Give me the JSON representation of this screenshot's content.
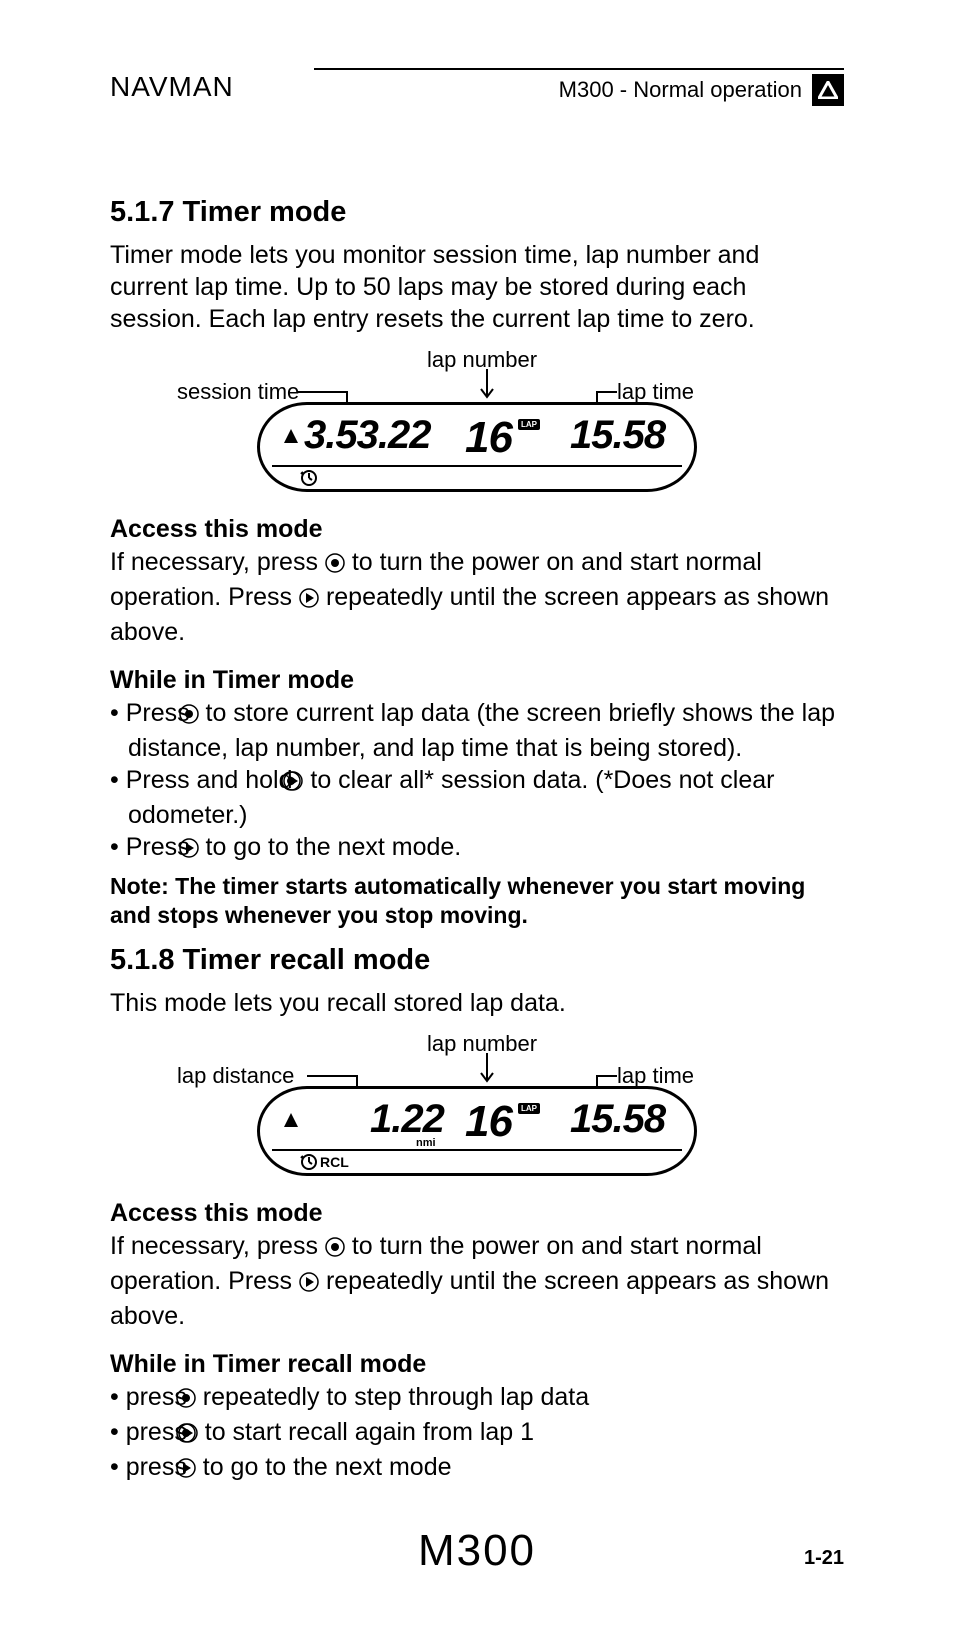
{
  "header": {
    "brand": "NAVMAN",
    "right": "M300 - Normal operation"
  },
  "section1": {
    "heading": "5.1.7 Timer mode",
    "intro": "Timer mode lets you monitor session time, lap number and current lap time. Up to 50 laps may be stored during each session. Each lap entry resets the current lap time to zero.",
    "fig": {
      "label_left": "session time",
      "label_mid": "lap number",
      "label_right": "lap time",
      "val_left": "3.53.22",
      "val_mid": "16",
      "val_right": "15.58",
      "lap_tag": "LAP"
    },
    "access_h": "Access this mode",
    "access_p1a": "If necessary, press ",
    "access_p1b": " to turn the power on and start normal operation. Press ",
    "access_p1c": " repeatedly until the screen appears as shown above.",
    "while_h": "While in Timer mode",
    "b1a": "Press ",
    "b1b": " to store current lap data (the screen briefly shows the lap distance, lap number, and lap time that is being stored).",
    "b2a": "Press and hold ",
    "b2b": " to clear all* session data. (*Does not clear odometer.)",
    "b3a": "Press ",
    "b3b": " to go to the next mode.",
    "note": "Note: The timer starts automatically whenever you start moving and stops whenever you stop moving."
  },
  "section2": {
    "heading": "5.1.8 Timer recall mode",
    "intro": "This mode lets you recall stored lap data.",
    "fig": {
      "label_left": "lap distance",
      "label_mid": "lap number",
      "label_right": "lap time",
      "val_left": "1.22",
      "val_mid": "16",
      "val_right": "15.58",
      "lap_tag": "LAP",
      "unit": "nmi",
      "rcl": "RCL"
    },
    "access_h": "Access this mode",
    "access_p1a": "If necessary, press ",
    "access_p1b": " to turn the power on and start normal operation. Press ",
    "access_p1c": " repeatedly until the screen appears as shown above.",
    "while_h": "While in Timer recall mode",
    "b1a": "press ",
    "b1b": " repeatedly to step through lap data",
    "b2a": "press ",
    "b2b": " to start recall again from lap 1",
    "b3a": "press ",
    "b3b": " to go to the next mode"
  },
  "footer": {
    "logo": "M300",
    "page": "1-21"
  }
}
